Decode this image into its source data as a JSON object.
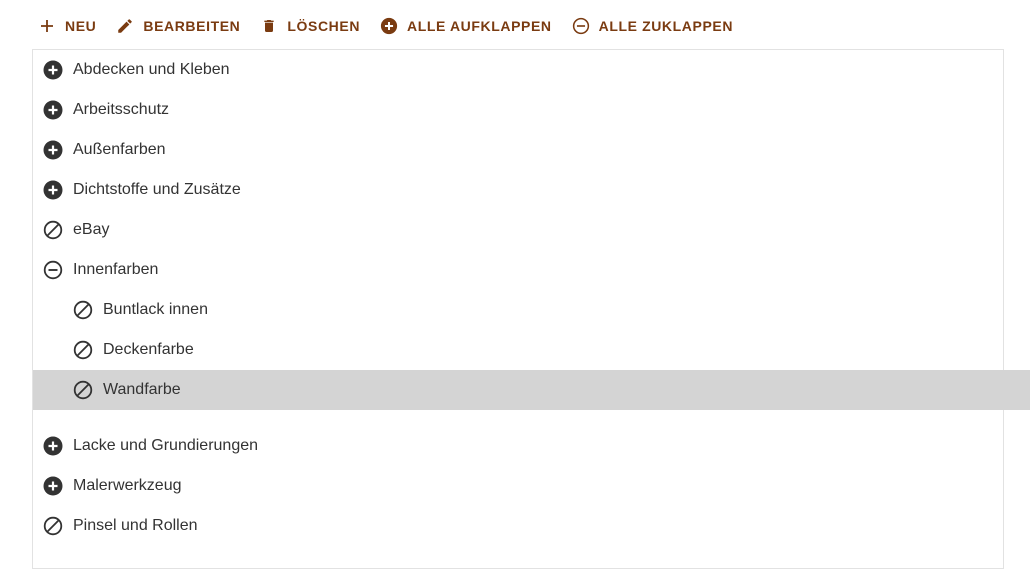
{
  "toolbar": {
    "new_label": "NEU",
    "edit_label": "BEARBEITEN",
    "delete_label": "LÖSCHEN",
    "expand_all_label": "ALLE AUFKLAPPEN",
    "collapse_all_label": "ALLE ZUKLAPPEN",
    "accent_color": "#7a3b11"
  },
  "tree": {
    "nodes": [
      {
        "label": "Abdecken und Kleben",
        "state": "collapsed",
        "icon": "plus-circle-icon"
      },
      {
        "label": "Arbeitsschutz",
        "state": "collapsed",
        "icon": "plus-circle-icon"
      },
      {
        "label": "Außenfarben",
        "state": "collapsed",
        "icon": "plus-circle-icon"
      },
      {
        "label": "Dichtstoffe und Zusätze",
        "state": "collapsed",
        "icon": "plus-circle-icon"
      },
      {
        "label": "eBay",
        "state": "leaf",
        "icon": "no-children-icon"
      },
      {
        "label": "Innenfarben",
        "state": "expanded",
        "icon": "minus-circle-icon"
      },
      {
        "label": "Buntlack innen",
        "state": "leaf",
        "icon": "no-children-icon",
        "level": 1
      },
      {
        "label": "Deckenfarbe",
        "state": "leaf",
        "icon": "no-children-icon",
        "level": 1
      },
      {
        "label": "Wandfarbe",
        "state": "leaf",
        "icon": "no-children-icon",
        "level": 1,
        "selected": true
      },
      {
        "label": "Lacke und Grundierungen",
        "state": "collapsed",
        "icon": "plus-circle-icon"
      },
      {
        "label": "Malerwerkzeug",
        "state": "collapsed",
        "icon": "plus-circle-icon"
      },
      {
        "label": "Pinsel und Rollen",
        "state": "leaf",
        "icon": "no-children-icon"
      }
    ],
    "selected_background": "#d4d4d4"
  }
}
